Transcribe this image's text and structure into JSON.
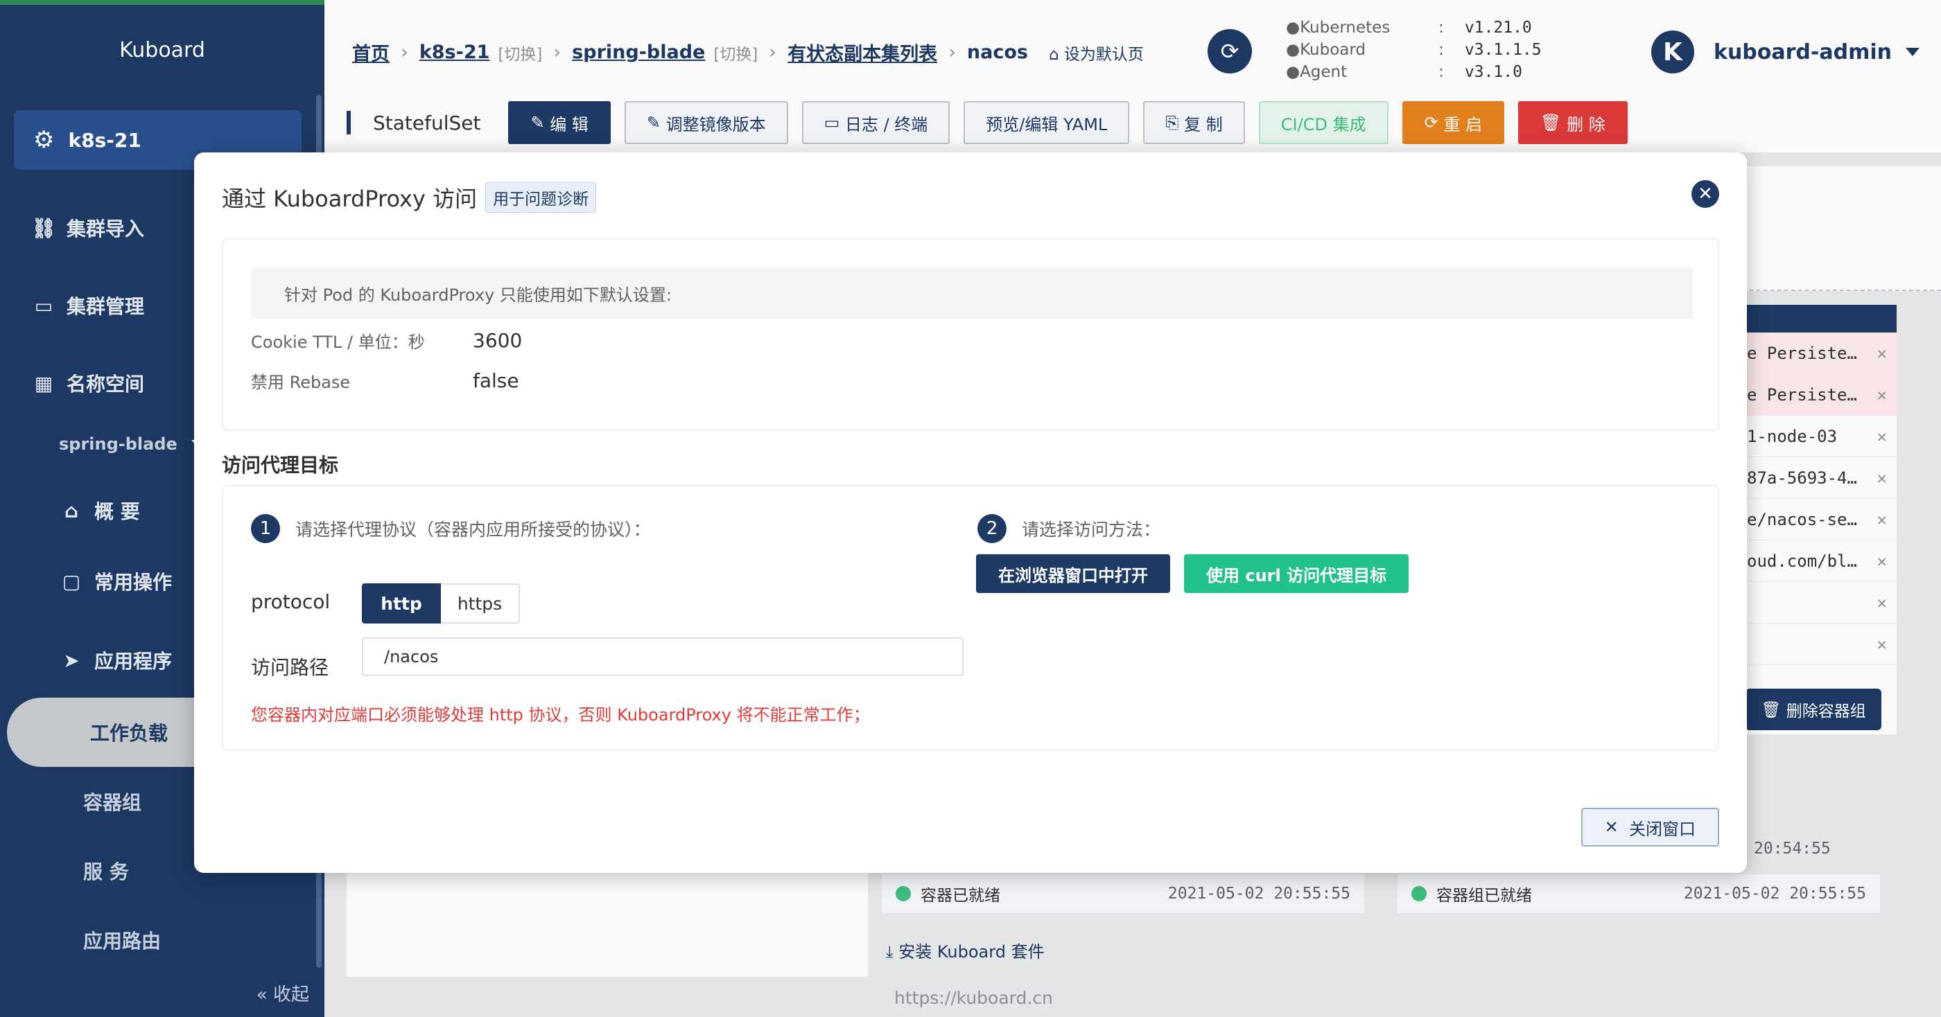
{
  "sidebar": {
    "brand": "Kuboard",
    "cluster": "k8s-21",
    "items": [
      {
        "label": "集群导入"
      },
      {
        "label": "集群管理"
      },
      {
        "label": "名称空间"
      }
    ],
    "namespace": "spring-blade",
    "sub_items": [
      {
        "label": "概 要"
      },
      {
        "label": "常用操作"
      },
      {
        "label": "应用程序"
      },
      {
        "label": "工作负载"
      },
      {
        "label": "容器组"
      },
      {
        "label": "服 务"
      },
      {
        "label": "应用路由"
      }
    ],
    "collapse": "收起"
  },
  "breadcrumb": {
    "home": "首页",
    "cluster": "k8s-21",
    "switch": "[切换]",
    "namespace": "spring-blade",
    "list": "有状态副本集列表",
    "current": "nacos",
    "set_default": "设为默认页"
  },
  "versions": [
    {
      "k": "Kubernetes",
      "v": "v1.21.0"
    },
    {
      "k": "Kuboard",
      "v": "v3.1.1.5"
    },
    {
      "k": "Agent",
      "v": "v3.1.0"
    }
  ],
  "user": {
    "initial": "K",
    "name": "kuboard-admin"
  },
  "toolbar": {
    "title": "StatefulSet",
    "buttons": [
      "编 辑",
      "调整镜像版本",
      "日志 / 终端",
      "预览/编辑 YAML",
      "复 制",
      "CI/CD 集成",
      "重 启",
      "删 除"
    ]
  },
  "background": {
    "right_rows": [
      "e Persiste…",
      "e Persiste…",
      "1-node-03",
      "87a-5693-4…",
      "e/nacos-se…",
      "oud.com/bl…",
      "",
      ""
    ],
    "delete_pod": "删除容器组",
    "time1": "20:54:55",
    "status": [
      {
        "label": "容器已就绪",
        "time": "2021-05-02 20:55:55"
      },
      {
        "label": "容器组已就绪",
        "time": "2021-05-02 20:55:55"
      }
    ],
    "install": "安装 Kuboard 套件",
    "footer": "https://kuboard.cn"
  },
  "modal": {
    "title": "通过 KuboardProxy 访问",
    "tag": "用于问题诊断",
    "note": "针对 Pod 的 KuboardProxy 只能使用如下默认设置:",
    "cookie_label": "Cookie TTL / 单位：秒",
    "cookie_value": "3600",
    "rebase_label": "禁用 Rebase",
    "rebase_value": "false",
    "section_title": "访问代理目标",
    "step1_num": "1",
    "step1": "请选择代理协议（容器内应用所接受的协议）：",
    "step2_num": "2",
    "step2": "请选择访问方法：",
    "protocol_label": "protocol",
    "protocol_options": [
      "http",
      "https"
    ],
    "path_label": "访问路径",
    "path_value": "/nacos",
    "warning": "您容器内对应端口必须能够处理 http 协议，否则 KuboardProxy 将不能正常工作；",
    "open_button": "在浏览器窗口中打开",
    "curl_button": "使用 curl 访问代理目标",
    "close_button": "关闭窗口"
  },
  "colors": {
    "primary": "#1e3a64",
    "green": "#22c08a",
    "orange": "#e6821e",
    "red": "#e03a3a"
  }
}
